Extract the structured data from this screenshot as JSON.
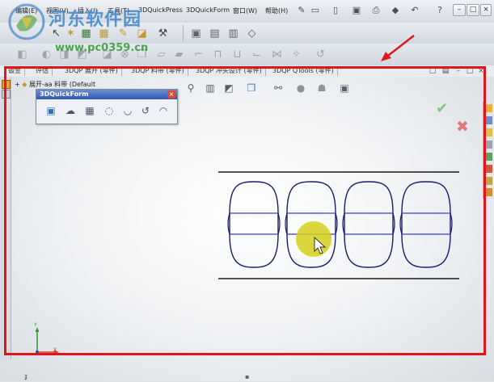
{
  "menu": {
    "items": [
      "编辑(E)",
      "视图(V)",
      "插入(I)",
      "工具(T)",
      "3DQuickPress",
      "3DQuickForm",
      "窗口(W)",
      "帮助(H)"
    ]
  },
  "watermark": {
    "site_name": "河东软件园",
    "url": "www.pc0359.cn"
  },
  "tabs": [
    "钣金",
    "评估",
    "3DQP 展开 (零件)",
    "3DQP 料带 (零件)",
    "3DQP 冲头设计 (零件)",
    "3DQP QTools (零件)"
  ],
  "tree": {
    "expand_symbol": "+",
    "label": "展开-aa 料带  (Default"
  },
  "quickform_panel": {
    "title": "3DQuickForm",
    "close_symbol": "×"
  },
  "confirm": {
    "ok_symbol": "✔",
    "cancel_symbol": "✖"
  },
  "triad": {
    "y_label": "Y",
    "x_label": "X"
  },
  "bottom": {
    "text": "ﾇ"
  },
  "icons": {
    "quick_access": [
      "new-document-icon",
      "open-icon",
      "save-icon",
      "print-icon",
      "undo-icon",
      "help-icon",
      "search-icon"
    ],
    "toolbar1": [
      "sketch-icon",
      "pointer-icon",
      "grid-icon",
      "grid-yellow-icon",
      "pencil-icon",
      "wrench-icon",
      "view1-icon",
      "view2-icon",
      "view3-icon",
      "eraser-icon"
    ],
    "toolbar2": [
      "extrude-icon",
      "revolve-icon",
      "cut-icon",
      "fillet-icon",
      "shell-icon",
      "mirror-icon",
      "delete-icon",
      "cube-icon",
      "fold-icon",
      "unfold-icon",
      "bend-icon",
      "flange-icon",
      "hem-icon",
      "jog-icon",
      "rip-icon",
      "corner-icon",
      "forming-icon",
      "curve-arrow-icon"
    ],
    "heads_up": [
      "zoom-fit-icon",
      "zoom-area-icon",
      "previous-view-icon",
      "section-view-icon",
      "view-orientation-icon",
      "display-style-icon",
      "hide-show-icon",
      "appearance-icon",
      "scene-icon",
      "view-settings-icon"
    ],
    "quickform_tools": [
      "form-tool-1-icon",
      "form-tool-2-icon",
      "form-tool-3-icon",
      "form-tool-4-icon",
      "form-tool-5-icon",
      "form-tool-6-icon",
      "form-tool-7-icon"
    ]
  },
  "colors": {
    "highlight_frame": "#e0161a",
    "cursor_highlight": "#d6cf1a",
    "sketch_lines": "#1a1a6e",
    "sketch_bands": "#3a3acf",
    "qf_titlebar": "#2d58b3"
  }
}
